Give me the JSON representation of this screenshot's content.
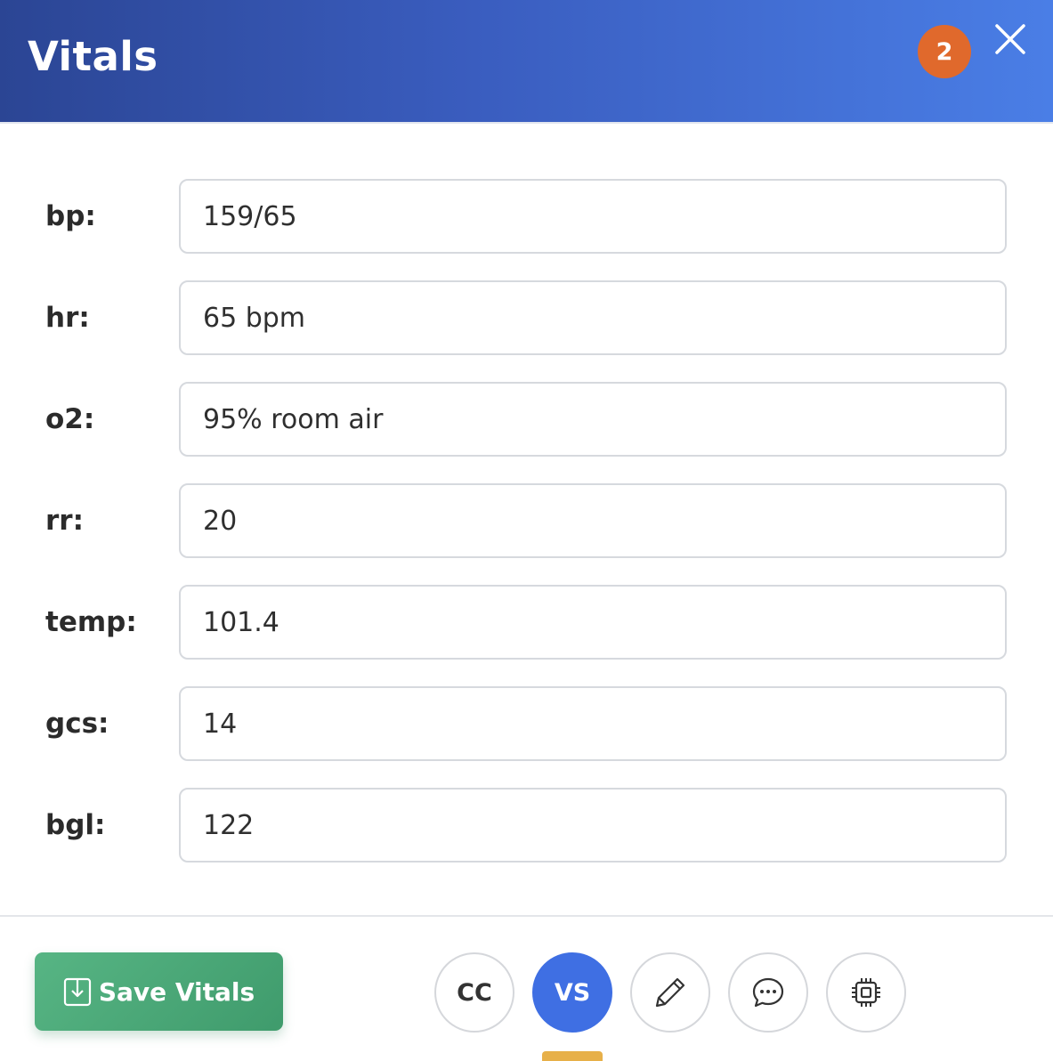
{
  "header": {
    "title": "Vitals",
    "badge_count": "2",
    "close_icon": "close-icon"
  },
  "vitals": [
    {
      "label": "bp:",
      "value": "159/65"
    },
    {
      "label": "hr:",
      "value": "65 bpm"
    },
    {
      "label": "o2:",
      "value": "95% room air"
    },
    {
      "label": "rr:",
      "value": "20"
    },
    {
      "label": "temp:",
      "value": "101.4"
    },
    {
      "label": "gcs:",
      "value": "14"
    },
    {
      "label": "bgl:",
      "value": "122"
    }
  ],
  "footer": {
    "save_label": "Save Vitals",
    "save_icon": "download-icon",
    "nav": [
      {
        "label": "CC",
        "active": false
      },
      {
        "label": "VS",
        "active": true
      },
      {
        "label": "",
        "icon": "pencil-icon",
        "active": false
      },
      {
        "label": "",
        "icon": "chat-bubble-icon",
        "active": false
      },
      {
        "label": "",
        "icon": "chip-icon",
        "active": false
      }
    ]
  },
  "colors": {
    "header_start": "#2b4594",
    "header_end": "#4a7ee6",
    "badge": "#e0692c",
    "save_button": "#4aa877",
    "active_nav": "#3f6fe3",
    "active_indicator": "#e7b049"
  }
}
